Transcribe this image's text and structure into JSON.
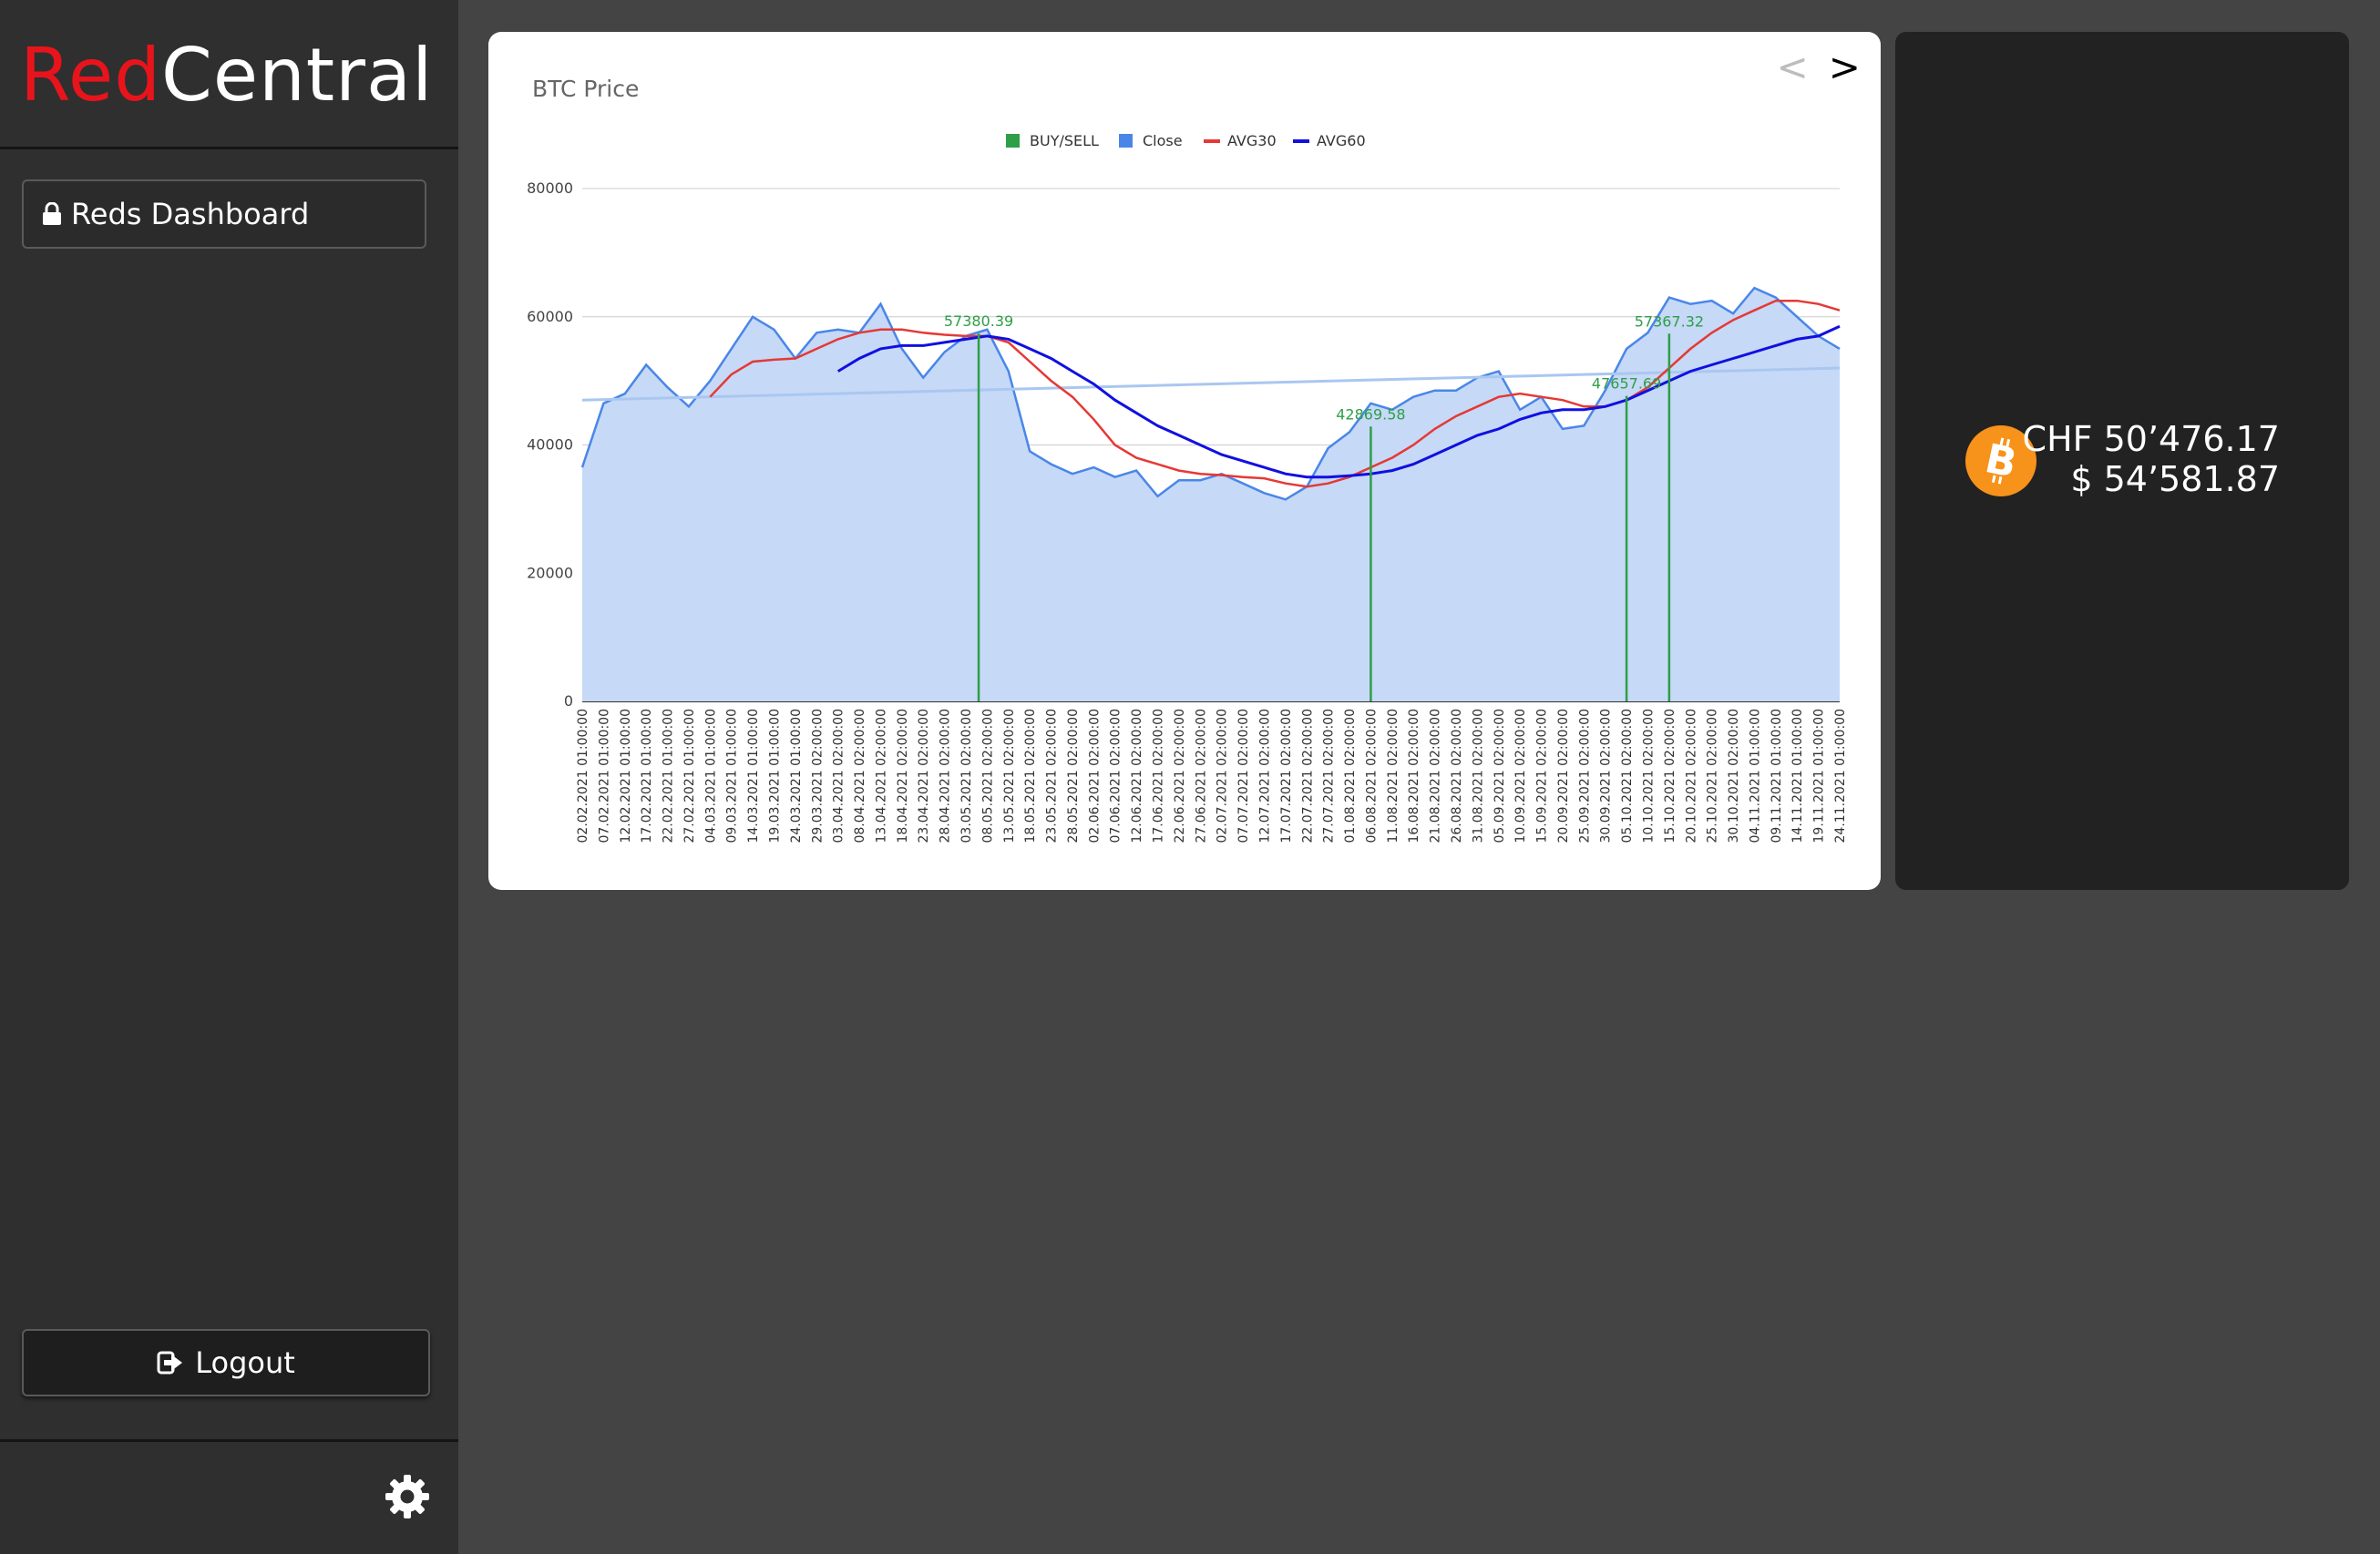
{
  "app": {
    "brand_red": "Red",
    "brand_white": "Central"
  },
  "sidebar": {
    "dashboard_label": "Reds Dashboard",
    "dashboard_icon": "lock-icon",
    "logout_label": "Logout",
    "logout_icon": "sign-out-icon",
    "settings_icon": "gear-icon"
  },
  "chart_nav": {
    "prev": "<",
    "next": ">"
  },
  "price": {
    "icon": "bitcoin-icon",
    "chf": "CHF 50’476.17",
    "usd": "$ 54’581.87"
  },
  "colors": {
    "brand_red": "#e8141c",
    "close_fill": "#c6d9f7",
    "close_line": "#4a86e8",
    "avg30": "#e53935",
    "avg60": "#1010e0",
    "buy_sell": "#2e9e47",
    "bitcoin": "#f7931a"
  },
  "chart_data": {
    "type": "area",
    "title": "BTC Price",
    "legend": [
      "BUY/SELL",
      "Close",
      "AVG30",
      "AVG60"
    ],
    "legend_position": "top",
    "ylim": [
      0,
      80000
    ],
    "yticks": [
      "0",
      "20000",
      "40000",
      "60000",
      "80000"
    ],
    "grid": true,
    "x": [
      "02.02.2021 01:00:00",
      "07.02.2021 01:00:00",
      "12.02.2021 01:00:00",
      "17.02.2021 01:00:00",
      "22.02.2021 01:00:00",
      "27.02.2021 01:00:00",
      "04.03.2021 01:00:00",
      "09.03.2021 01:00:00",
      "14.03.2021 01:00:00",
      "19.03.2021 01:00:00",
      "24.03.2021 01:00:00",
      "29.03.2021 02:00:00",
      "03.04.2021 02:00:00",
      "08.04.2021 02:00:00",
      "13.04.2021 02:00:00",
      "18.04.2021 02:00:00",
      "23.04.2021 02:00:00",
      "28.04.2021 02:00:00",
      "03.05.2021 02:00:00",
      "08.05.2021 02:00:00",
      "13.05.2021 02:00:00",
      "18.05.2021 02:00:00",
      "23.05.2021 02:00:00",
      "28.05.2021 02:00:00",
      "02.06.2021 02:00:00",
      "07.06.2021 02:00:00",
      "12.06.2021 02:00:00",
      "17.06.2021 02:00:00",
      "22.06.2021 02:00:00",
      "27.06.2021 02:00:00",
      "02.07.2021 02:00:00",
      "07.07.2021 02:00:00",
      "12.07.2021 02:00:00",
      "17.07.2021 02:00:00",
      "22.07.2021 02:00:00",
      "27.07.2021 02:00:00",
      "01.08.2021 02:00:00",
      "06.08.2021 02:00:00",
      "11.08.2021 02:00:00",
      "16.08.2021 02:00:00",
      "21.08.2021 02:00:00",
      "26.08.2021 02:00:00",
      "31.08.2021 02:00:00",
      "05.09.2021 02:00:00",
      "10.09.2021 02:00:00",
      "15.09.2021 02:00:00",
      "20.09.2021 02:00:00",
      "25.09.2021 02:00:00",
      "30.09.2021 02:00:00",
      "05.10.2021 02:00:00",
      "10.10.2021 02:00:00",
      "15.10.2021 02:00:00",
      "20.10.2021 02:00:00",
      "25.10.2021 02:00:00",
      "30.10.2021 02:00:00",
      "04.11.2021 01:00:00",
      "09.11.2021 01:00:00",
      "14.11.2021 01:00:00",
      "19.11.2021 01:00:00",
      "24.11.2021 01:00:00"
    ],
    "series": [
      {
        "name": "Close",
        "values": [
          36500,
          46500,
          48000,
          52500,
          49000,
          46000,
          50000,
          55000,
          60000,
          58000,
          53500,
          57500,
          58000,
          57500,
          62000,
          55000,
          50500,
          54500,
          57000,
          58000,
          51500,
          39000,
          37000,
          35500,
          36500,
          35000,
          36000,
          32000,
          34500,
          34500,
          35500,
          34000,
          32500,
          31500,
          33500,
          39500,
          42000,
          46500,
          45500,
          47500,
          48500,
          48500,
          50500,
          51500,
          45500,
          47500,
          42500,
          43000,
          48500,
          55000,
          57500,
          63000,
          62000,
          62500,
          60500,
          64500,
          63000,
          60000,
          57000,
          55000
        ],
        "line_style": "line"
      },
      {
        "name": "AVG30",
        "values": [
          null,
          null,
          null,
          null,
          null,
          null,
          47500,
          51000,
          53000,
          53300,
          53500,
          55000,
          56500,
          57500,
          58000,
          58000,
          57500,
          57200,
          57000,
          57000,
          56000,
          53000,
          50000,
          47500,
          44000,
          40000,
          38000,
          37000,
          36000,
          35500,
          35300,
          35000,
          34800,
          34000,
          33500,
          34000,
          35000,
          36500,
          38000,
          40000,
          42500,
          44500,
          46000,
          47500,
          48000,
          47500,
          47000,
          46000,
          46000,
          47000,
          49000,
          52000,
          55000,
          57500,
          59500,
          61000,
          62500,
          62500,
          62000,
          61000
        ]
      },
      {
        "name": "AVG60",
        "values": [
          null,
          null,
          null,
          null,
          null,
          null,
          null,
          null,
          null,
          null,
          null,
          null,
          51500,
          53500,
          55000,
          55500,
          55500,
          56000,
          56500,
          57000,
          56500,
          55000,
          53500,
          51500,
          49500,
          47000,
          45000,
          43000,
          41500,
          40000,
          38500,
          37500,
          36500,
          35500,
          35000,
          35000,
          35200,
          35500,
          36000,
          37000,
          38500,
          40000,
          41500,
          42500,
          44000,
          45000,
          45500,
          45500,
          46000,
          47000,
          48500,
          50000,
          51500,
          52500,
          53500,
          54500,
          55500,
          56500,
          57000,
          58500
        ]
      },
      {
        "name": "BUY/SELL",
        "points": [
          {
            "x": "06.05.2021 02:00:00",
            "value": 57380.39
          },
          {
            "x": "06.08.2021 02:00:00",
            "value": 42869.58
          },
          {
            "x": "05.10.2021 02:00:00",
            "value": 47657.69
          },
          {
            "x": "15.10.2021 02:00:00",
            "value": 57367.32
          }
        ]
      }
    ],
    "trendline": {
      "from": 47000,
      "to": 52000
    },
    "data_labels": [
      "57380.39",
      "42869.58",
      "47657.69",
      "57367.32"
    ]
  }
}
